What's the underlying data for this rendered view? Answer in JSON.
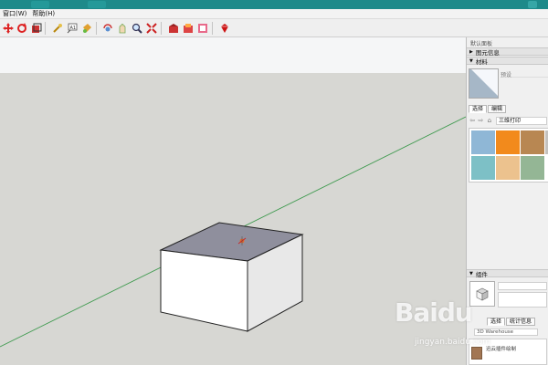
{
  "menubar": {
    "items": [
      "窗口(W)",
      "帮助(H)"
    ]
  },
  "toolbar": {
    "tools": [
      "select-icon",
      "component-icon",
      "paint-icon",
      "eraser-icon",
      "line-icon",
      "text-icon",
      "tape-icon",
      "orbit-icon",
      "pan-icon",
      "zoom-icon",
      "zoom-extents-icon",
      "warehouse-icon",
      "share-icon",
      "extension-icon",
      "ruby-icon"
    ]
  },
  "tray": {
    "title": "默认面板",
    "entity_info": "图元信息",
    "materials": "材料",
    "material_name": "预设",
    "tab_select": "选择",
    "tab_edit": "编辑",
    "library": "三维打印",
    "swatch_colors": [
      "#8fb7d6",
      "#f28a1c",
      "#b88752",
      "#c4c2bf",
      "#7dc0c6",
      "#ecc28e",
      "#94b695"
    ],
    "components": "组件",
    "comp_tab_1": "选择",
    "comp_tab_2": "统计信息",
    "search_text": "3D Warehouse",
    "comp_item": "迅云插件绘制"
  },
  "watermark": {
    "logo": "Baidu",
    "sub": "jingyan.baidu.com"
  },
  "colors": {
    "canvas_sky": "#f5f6f7",
    "canvas_ground": "#d7d7d3",
    "top_face": "#8f8f9d",
    "front_face": "#ffffff",
    "side_face": "#e8e8e8",
    "axis_green": "#3f9a4f"
  }
}
